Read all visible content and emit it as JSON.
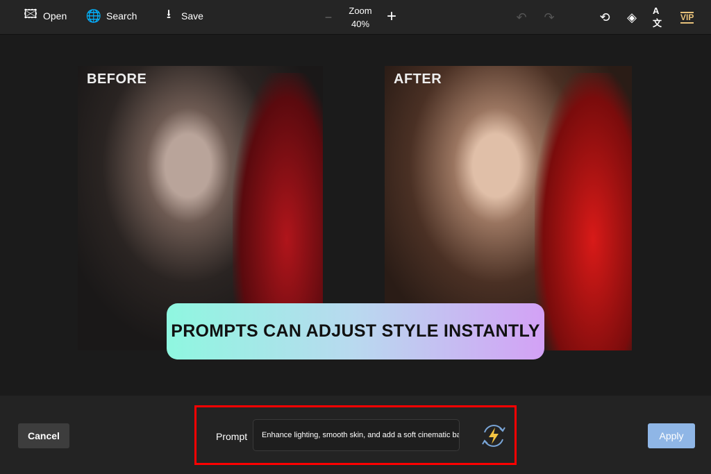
{
  "toolbar": {
    "open": "Open",
    "search": "Search",
    "save": "Save",
    "zoom_label": "Zoom",
    "zoom_value": "40%",
    "vip": "VIP"
  },
  "images": {
    "before": "BEFORE",
    "after": "AFTER"
  },
  "banner": "PROMPTS CAN ADJUST STYLE INSTANTLY",
  "footer": {
    "cancel": "Cancel",
    "prompt_label": "Prompt",
    "prompt_value": "Enhance lighting, smooth skin, and add a soft cinematic back",
    "apply": "Apply"
  },
  "colors": {
    "vip": "#e8c27a",
    "apply": "#8fb6e6",
    "highlight": "#ff0000"
  }
}
